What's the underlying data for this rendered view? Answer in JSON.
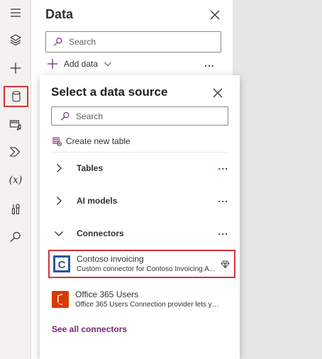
{
  "rail": {
    "items": [
      {
        "name": "tree-view",
        "icon": "layers-icon"
      },
      {
        "name": "insert",
        "icon": "plus-icon"
      },
      {
        "name": "data",
        "icon": "database-icon",
        "active": true
      },
      {
        "name": "media",
        "icon": "media-icon"
      },
      {
        "name": "power-automate",
        "icon": "power-automate-icon"
      },
      {
        "name": "variables",
        "icon": "variable-icon",
        "label": "(x)"
      },
      {
        "name": "advanced-tools",
        "icon": "tools-icon"
      },
      {
        "name": "search",
        "icon": "search-icon"
      }
    ]
  },
  "data_panel": {
    "title": "Data",
    "search_placeholder": "Search",
    "add_data_label": "Add data",
    "more_label": "..."
  },
  "flyout": {
    "title": "Select a data source",
    "search_placeholder": "Search",
    "create_table_label": "Create new table",
    "sections": [
      {
        "label": "Tables",
        "expanded": false,
        "more": "..."
      },
      {
        "label": "AI models",
        "expanded": false,
        "more": "..."
      },
      {
        "label": "Connectors",
        "expanded": true,
        "more": "..."
      }
    ],
    "connectors": [
      {
        "name": "Contoso invoicing",
        "description": "Custom connector for Contoso Invoicing A...",
        "logo": "contoso-logo",
        "premium": true,
        "highlighted": true
      },
      {
        "name": "Office 365 Users",
        "description": "Office 365 Users Connection provider lets you ...",
        "logo": "office-logo",
        "premium": false,
        "highlighted": false
      }
    ],
    "see_all_label": "See all connectors"
  },
  "colors": {
    "accent": "#742774",
    "highlight": "#d13438",
    "contoso_brand": "#2b579a",
    "office_brand": "#d83b01"
  }
}
